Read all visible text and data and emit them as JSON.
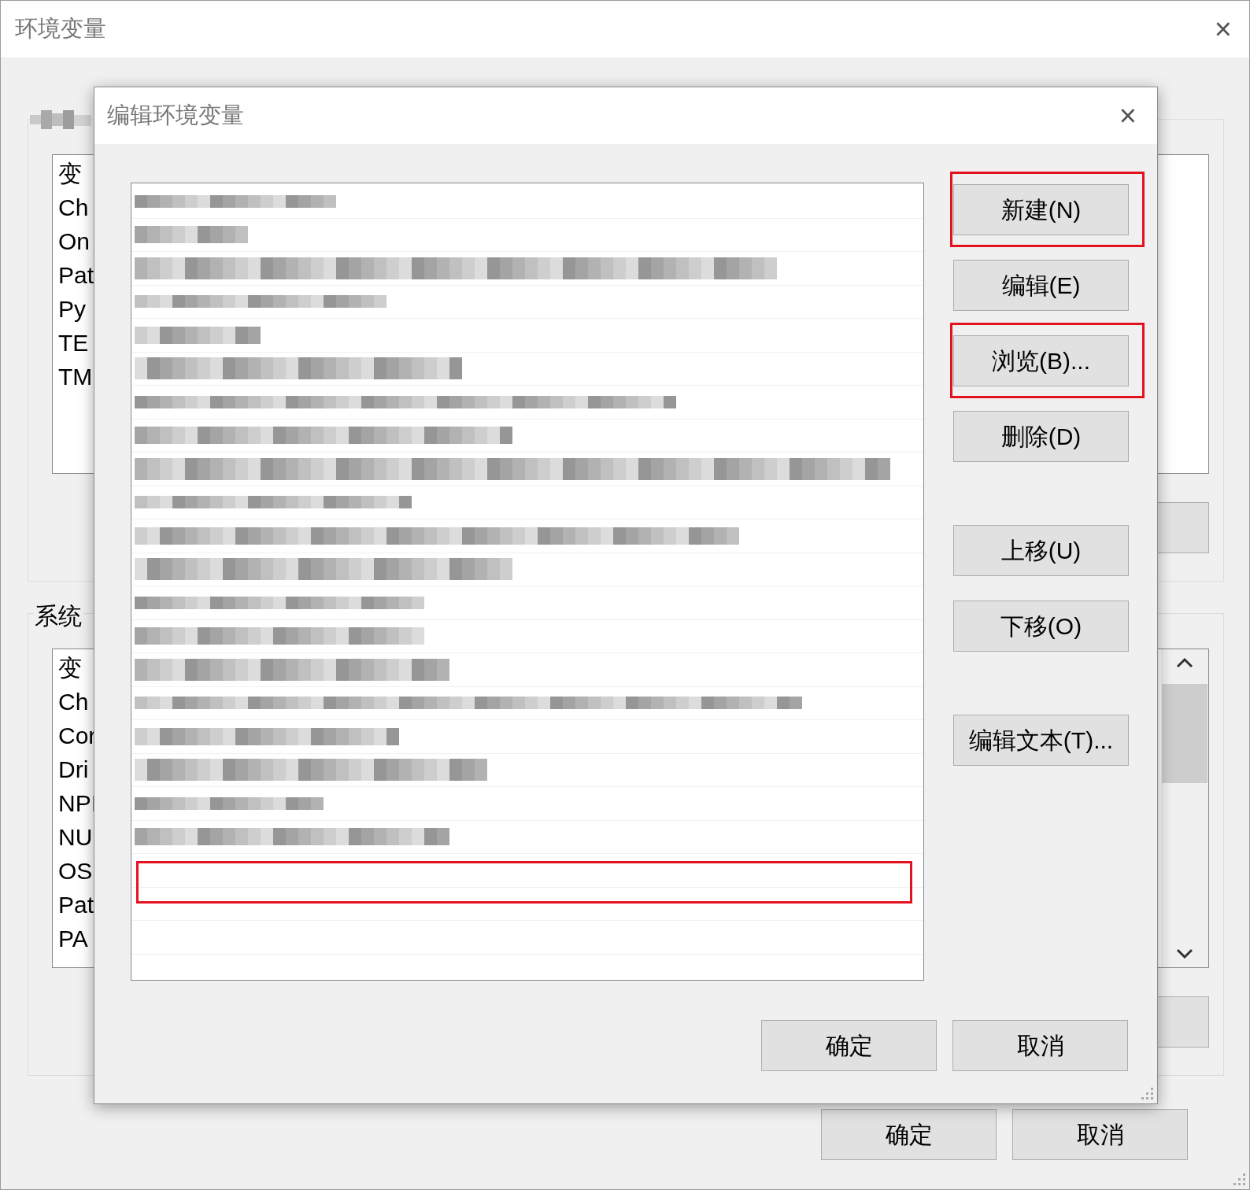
{
  "window": {
    "title": "环境变量",
    "close": "×"
  },
  "user_group": {
    "list": [
      "变",
      "Ch",
      "On",
      "Pat",
      "Py",
      "TE",
      "TM"
    ]
  },
  "system_group": {
    "label": "系统",
    "list": [
      "变",
      "Ch",
      "Cor",
      "Dri",
      "NPI",
      "NU",
      "OS",
      "Pat",
      "PA"
    ]
  },
  "buttons": [
    "确定",
    "取消"
  ],
  "dialog": {
    "title": "编辑环境变量",
    "close": "×",
    "entries": [
      {
        "kind": "blurred"
      },
      {
        "kind": "blurred"
      },
      {
        "kind": "blurred"
      },
      {
        "kind": "blurred"
      },
      {
        "kind": "blurred"
      },
      {
        "kind": "blurred"
      },
      {
        "kind": "blurred"
      },
      {
        "kind": "blurred"
      },
      {
        "kind": "blurred"
      },
      {
        "kind": "blurred"
      },
      {
        "kind": "blurred"
      },
      {
        "kind": "blurred"
      },
      {
        "kind": "blurred"
      },
      {
        "kind": "blurred"
      },
      {
        "kind": "blurred"
      },
      {
        "kind": "blurred"
      },
      {
        "kind": "blurred"
      },
      {
        "kind": "blurred"
      },
      {
        "kind": "blurred"
      },
      {
        "kind": "blurred"
      },
      {
        "kind": "empty",
        "annotated": true
      },
      {
        "kind": "empty",
        "annotated": false
      },
      {
        "kind": "empty",
        "annotated": false
      }
    ],
    "side_buttons": [
      [
        {
          "label": "新建(N)",
          "annotated": true
        },
        {
          "label": "编辑(E)",
          "annotated": false
        },
        {
          "label": "浏览(B)...",
          "annotated": true
        },
        {
          "label": "删除(D)",
          "annotated": false
        }
      ],
      [
        {
          "label": "上移(U)",
          "annotated": false
        },
        {
          "label": "下移(O)",
          "annotated": false
        }
      ],
      [
        {
          "label": "编辑文本(T)...",
          "annotated": false
        }
      ]
    ],
    "buttons": [
      "确定",
      "取消"
    ]
  }
}
